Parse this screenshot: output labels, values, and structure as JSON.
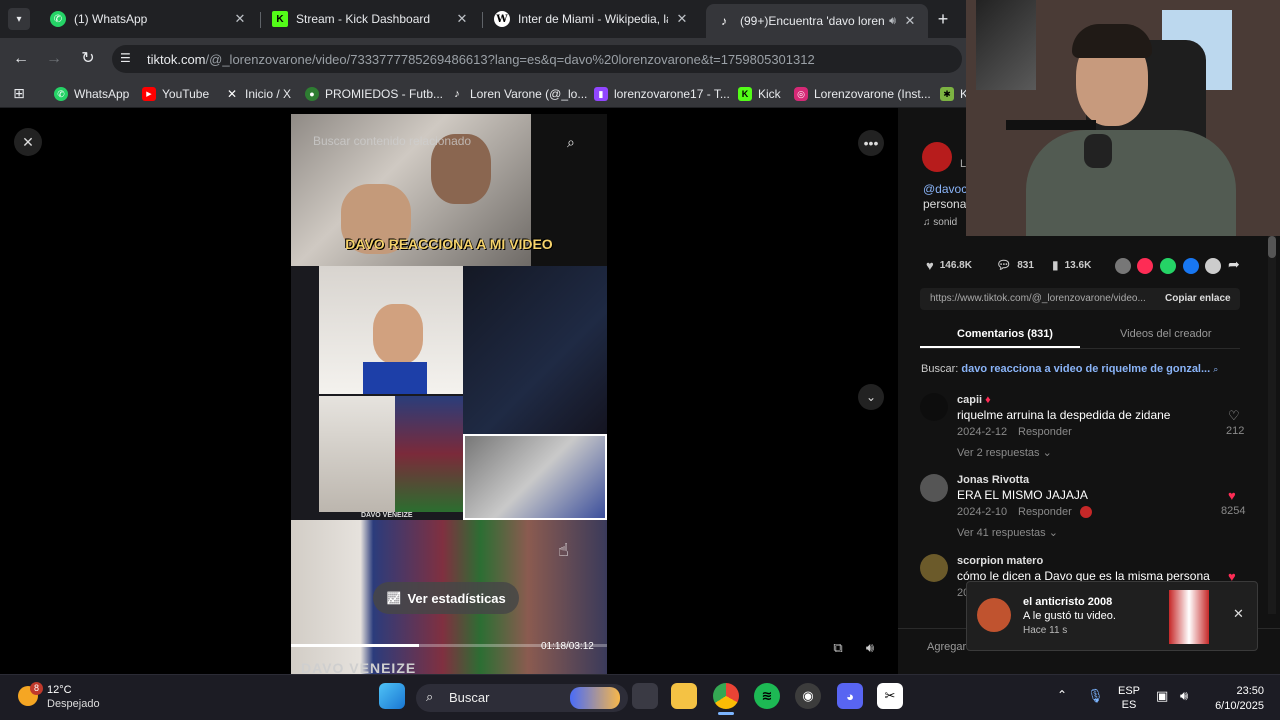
{
  "tabs": [
    {
      "title": "(1) WhatsApp",
      "icon": "whatsapp-icon"
    },
    {
      "title": "Stream - Kick Dashboard",
      "icon": "kick-icon"
    },
    {
      "title": "Inter de Miami - Wikipedia, la e",
      "icon": "wikipedia-icon"
    },
    {
      "title": "(99+)Encuentra 'davo loren",
      "icon": "tiktok-icon"
    }
  ],
  "new_tab_label": "+",
  "address": {
    "host": "tiktok.com",
    "path": "/@_lorenzovarone/video/7333777785269486613?lang=es&q=davo%20lorenzovarone&t=1759805301312"
  },
  "bookmarks": [
    {
      "label": "WhatsApp"
    },
    {
      "label": "YouTube"
    },
    {
      "label": "Inicio / X"
    },
    {
      "label": "PROMIEDOS - Futb..."
    },
    {
      "label": "Loren Varone (@_lo..."
    },
    {
      "label": "lorenzovarone17 - T..."
    },
    {
      "label": "Kick"
    },
    {
      "label": "Lorenzovarone (Inst..."
    },
    {
      "label": "K"
    }
  ],
  "video": {
    "search_placeholder": "Buscar contenido relacionado",
    "caption": "DAVO REACCIONA A MI VIDEO",
    "stats_button": "Ver estadísticas",
    "time": "01:18/03:12",
    "watermark": "DAVO VENEIZE",
    "watermark_small": "DAVO VENEIZE"
  },
  "post": {
    "author_handle": "@davoc",
    "author_line": "L",
    "desc": "persona",
    "sound": "sonid",
    "likes": "146.8K",
    "comments": "831",
    "saves": "13.6K",
    "link": "https://www.tiktok.com/@_lorenzovarone/video...",
    "copy_link": "Copiar enlace"
  },
  "tabs2": {
    "comments": "Comentarios (831)",
    "creator_videos": "Videos del creador"
  },
  "search": {
    "label": "Buscar:",
    "query": "davo reacciona a video de riquelme de gonzal..."
  },
  "comments": [
    {
      "name": "capii",
      "text": "riquelme arruina la despedida de zidane",
      "date": "2024-2-12",
      "reply": "Responder",
      "likes": "212",
      "more": "Ver 2 respuestas",
      "liked": false
    },
    {
      "name": "Jonas Rivotta",
      "text": "ERA EL MISMO JAJAJA",
      "date": "2024-2-10",
      "reply": "Responder",
      "likes": "8254",
      "more": "Ver 41 respuestas",
      "liked": true
    },
    {
      "name": "scorpion matero",
      "text": "cómo le dicen a Davo que es la misma persona",
      "date": "20",
      "reply": "",
      "likes": "",
      "more": "",
      "liked": true
    }
  ],
  "add_comment": "Agregar",
  "notification": {
    "user": "el anticristo 2008",
    "text": "A le gustó tu video.",
    "time": "Hace 11 s"
  },
  "taskbar": {
    "temp": "12°C",
    "weather": "Despejado",
    "weather_badge": "8",
    "search": "Buscar",
    "lang1": "ESP",
    "lang2": "ES",
    "time": "23:50",
    "date": "6/10/2025"
  },
  "colors": {
    "tiktok_red": "#fe2c55",
    "link_blue": "#8ab4f8"
  }
}
